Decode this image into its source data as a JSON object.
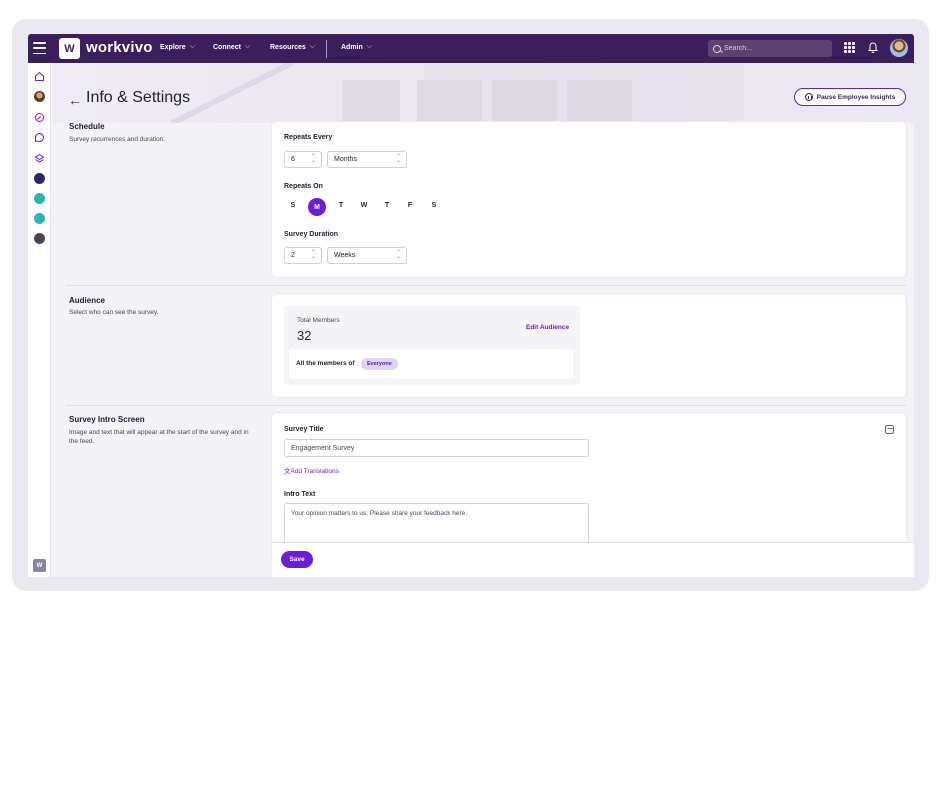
{
  "header": {
    "logo_text": "W",
    "brand": "workvivo",
    "nav": [
      {
        "label": "Explore"
      },
      {
        "label": "Connect"
      },
      {
        "label": "Resources"
      },
      {
        "label": "Admin"
      }
    ],
    "search_placeholder": "Search..."
  },
  "page": {
    "title": "Info & Settings",
    "pause_button": "Pause Employee Insights"
  },
  "schedule": {
    "title": "Schedule",
    "description": "Survey recurrences and duration.",
    "repeats_every_label": "Repeats Every",
    "repeats_every_value": "6",
    "repeats_every_unit": "Months",
    "repeats_on_label": "Repeats On",
    "days": [
      "S",
      "M",
      "T",
      "W",
      "T",
      "F",
      "S"
    ],
    "selected_day": "M",
    "duration_label": "Survey Duration",
    "duration_value": "2",
    "duration_unit": "Weeks"
  },
  "audience": {
    "title": "Audience",
    "description": "Select who can see the survey.",
    "total_members_label": "Total Members",
    "total_members": "32",
    "edit_link": "Edit Audience",
    "members_text": "All the members of",
    "group_badge": "Everyone"
  },
  "intro": {
    "title": "Survey Intro Screen",
    "description": "Image and text that will appear at the start of the survey and in the feed.",
    "survey_title_label": "Survey Title",
    "survey_title_value": "Engagement Survey",
    "add_translations": "Add Translations",
    "intro_text_label": "Intro Text",
    "intro_text_value": "Your opinion matters to us. Please share your feedback here."
  },
  "footer": {
    "save_label": "Save"
  }
}
